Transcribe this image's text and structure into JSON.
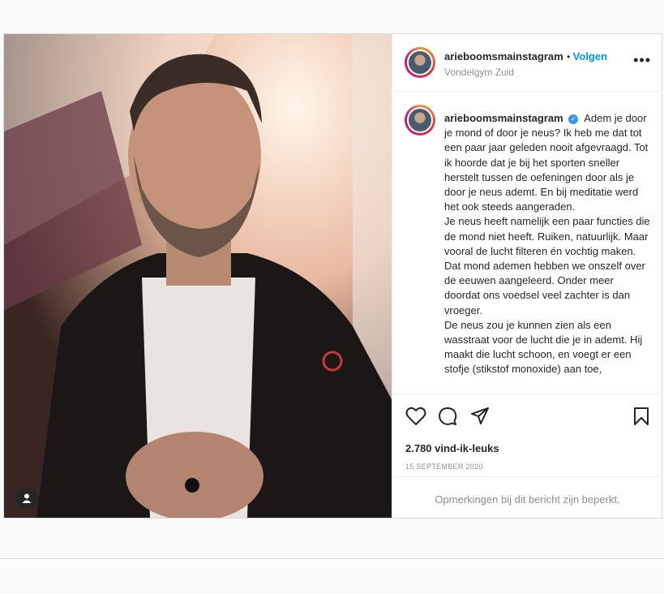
{
  "post": {
    "username": "arieboomsmainstagram",
    "follow_label": "Volgen",
    "location": "Vondelgym Zuid",
    "more_label": "•••",
    "caption_paragraphs": [
      "Adem je door je mond of door je neus? Ik heb me dat tot een paar jaar geleden nooit afgevraagd. Tot ik hoorde dat je bij het sporten sneller herstelt tussen de oefeningen door als je door je neus ademt. En bij meditatie werd het ook steeds aangeraden.",
      "Je neus heeft namelijk een paar functies die de mond niet heeft. Ruiken, natuurlijk. Maar vooral de lucht filteren én vochtig maken. Dat mond ademen hebben we onszelf over de eeuwen aangeleerd. Onder meer doordat ons voedsel veel zachter is dan vroeger.",
      "De neus zou je kunnen zien als een wasstraat voor de lucht die je in ademt. Hij maakt die lucht schoon, en voegt er een stofje (stikstof monoxide) aan toe,"
    ],
    "likes": "2.780 vind-ik-leuks",
    "date": "15 september 2020",
    "comments_restricted": "Opmerkingen bij dit bericht zijn beperkt."
  },
  "icons": {
    "like": "heart-icon",
    "comment": "comment-icon",
    "share": "paper-plane-icon",
    "save": "bookmark-icon",
    "tags": "user-tag-icon",
    "verified": "verified-badge-icon"
  },
  "colors": {
    "follow": "#0095f6",
    "verified": "#3897f0",
    "muted": "#8e8e8e",
    "text": "#262626"
  }
}
